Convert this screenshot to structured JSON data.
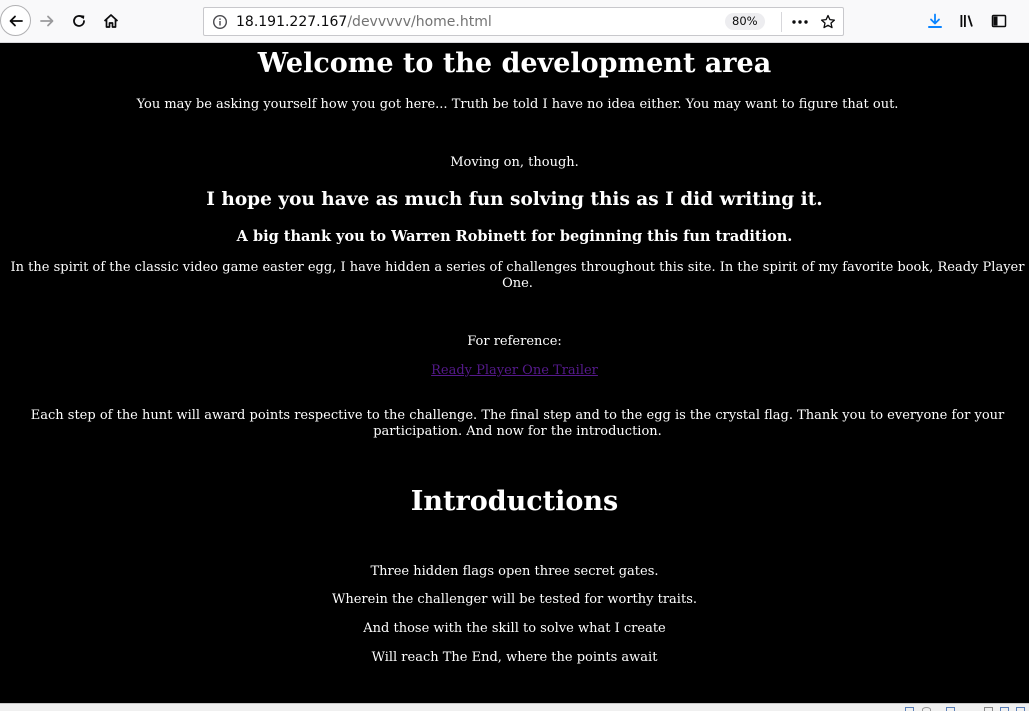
{
  "browser": {
    "url_host": "18.191.227.167",
    "url_path": "/devvvvv/home.html",
    "zoom": "80%",
    "icons": {
      "back": "back-arrow-icon",
      "forward": "forward-arrow-icon",
      "reload": "reload-icon",
      "home": "home-icon",
      "info": "site-info-icon",
      "more": "page-actions-icon",
      "bookmark": "bookmark-star-icon",
      "downloads": "download-icon",
      "library": "library-icon",
      "sidebar": "sidebar-icon"
    },
    "colors": {
      "toolbar_bg": "#f9f9fa",
      "download_accent": "#0a84ff"
    }
  },
  "page": {
    "title": "Welcome to the development area",
    "intro": "You may be asking yourself how you got here... Truth be told I have no idea either. You may want to figure that out.",
    "moving_on": "Moving on, though.",
    "hope_heading": "I hope you have as much fun solving this as I did writing it.",
    "thanks_heading": "A big thank you to Warren Robinett for beginning this fun tradition.",
    "spirit_paragraph": "In the spirit of the classic video game easter egg, I have hidden a series of challenges throughout this site. In the spirit of my favorite book, Ready Player One.",
    "reference_label": "For reference:",
    "trailer_link": "Ready Player One Trailer",
    "hunt_paragraph": "Each step of the hunt will award points respective to the challenge. The final step and to the egg is the crystal flag. Thank you to everyone for your participation. And now for the introduction.",
    "introductions_heading": "Introductions",
    "poem": [
      "Three hidden flags open three secret gates.",
      "Wherein the challenger will be tested for worthy traits.",
      "And those with the skill to solve what I create",
      "Will reach The End, where the points await"
    ],
    "colors": {
      "background": "#000000",
      "text": "#ffffff",
      "link": "#551a8b"
    }
  }
}
